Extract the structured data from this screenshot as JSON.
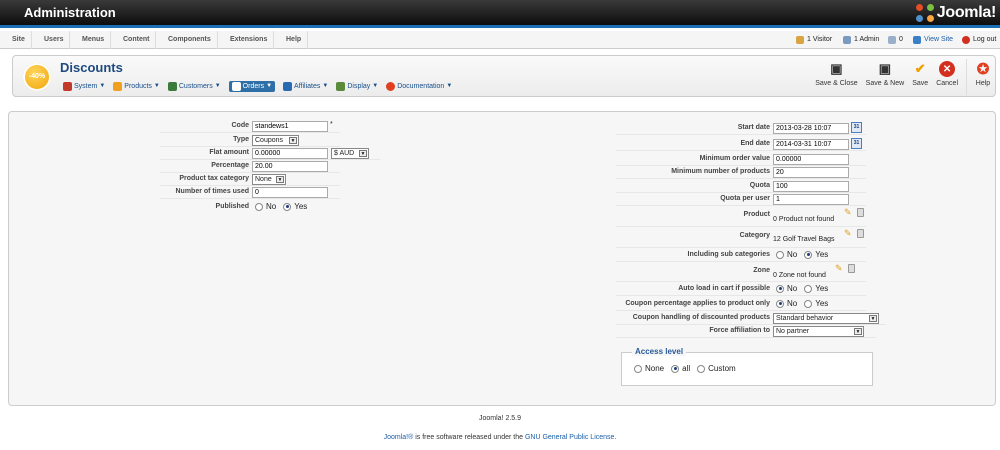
{
  "header": {
    "title": "Administration",
    "logo_text": "Joomla!"
  },
  "menubar": {
    "items": [
      "Site",
      "Users",
      "Menus",
      "Content",
      "Components",
      "Extensions",
      "Help"
    ],
    "visitors": "1 Visitor",
    "admins": "1 Admin",
    "messages": "0",
    "view_site": "View Site",
    "logout": "Log out"
  },
  "toolbar": {
    "badge": "-40%",
    "page_title": "Discounts",
    "submenu": [
      {
        "label": "System",
        "icon": "tools-icon",
        "color": "#c0392b"
      },
      {
        "label": "Products",
        "icon": "box-icon",
        "color": "#f0a020"
      },
      {
        "label": "Customers",
        "icon": "users-icon",
        "color": "#3a7a3a"
      },
      {
        "label": "Orders",
        "icon": "orders-icon",
        "color": "#ffffff"
      },
      {
        "label": "Affiliates",
        "icon": "affiliates-icon",
        "color": "#2a6ab0"
      },
      {
        "label": "Display",
        "icon": "display-icon",
        "color": "#5a8a3a"
      },
      {
        "label": "Documentation",
        "icon": "lifebuoy-icon",
        "color": "#e04020"
      }
    ],
    "buttons": {
      "save_close": "Save & Close",
      "save_new": "Save & New",
      "save": "Save",
      "cancel": "Cancel",
      "help": "Help"
    }
  },
  "left_form": {
    "code": {
      "label": "Code",
      "value": "standews1",
      "required": "*"
    },
    "type": {
      "label": "Type",
      "value": "Coupons"
    },
    "flat_amount": {
      "label": "Flat amount",
      "value": "0.00000",
      "currency": "$ AUD"
    },
    "percentage": {
      "label": "Percentage",
      "value": "20.00"
    },
    "product_tax_category": {
      "label": "Product tax category",
      "value": "None"
    },
    "times_used": {
      "label": "Number of times used",
      "value": "0"
    },
    "published": {
      "label": "Published",
      "no": "No",
      "yes": "Yes",
      "selected": "Yes"
    }
  },
  "right_form": {
    "start_date": {
      "label": "Start date",
      "value": "2013-03-28 10:07",
      "cal": "31"
    },
    "end_date": {
      "label": "End date",
      "value": "2014-03-31 10:07",
      "cal": "31"
    },
    "min_order_value": {
      "label": "Minimum order value",
      "value": "0.00000"
    },
    "min_products": {
      "label": "Minimum number of products",
      "value": "20"
    },
    "quota": {
      "label": "Quota",
      "value": "100"
    },
    "quota_per_user": {
      "label": "Quota per user",
      "value": "1"
    },
    "product": {
      "label": "Product",
      "value": "0 Product not found"
    },
    "category": {
      "label": "Category",
      "value": "12 Golf Travel Bags"
    },
    "sub_categories": {
      "label": "Including sub categories",
      "no": "No",
      "yes": "Yes",
      "selected": "Yes"
    },
    "zone": {
      "label": "Zone",
      "value": "0 Zone not found"
    },
    "auto_load": {
      "label": "Auto load in cart if possible",
      "no": "No",
      "yes": "Yes",
      "selected": "No"
    },
    "coupon_pct": {
      "label": "Coupon percentage applies to product only",
      "no": "No",
      "yes": "Yes",
      "selected": "No"
    },
    "handling": {
      "label": "Coupon handling of discounted products",
      "value": "Standard behavior"
    },
    "affiliation": {
      "label": "Force affiliation to",
      "value": "No partner"
    }
  },
  "access": {
    "legend": "Access level",
    "options": [
      "None",
      "all",
      "Custom"
    ],
    "selected": "all"
  },
  "footer": {
    "version": "Joomla! 2.5.9",
    "joomla_link": "Joomla!®",
    "middle": " is free software released under the ",
    "license_link": "GNU General Public License",
    "end": "."
  }
}
